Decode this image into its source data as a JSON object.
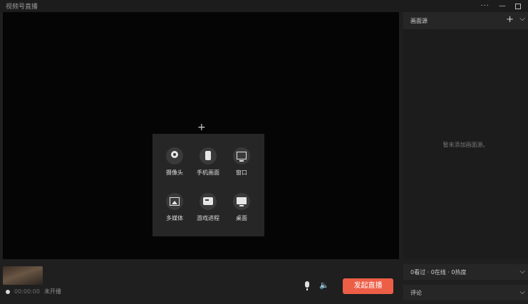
{
  "window": {
    "title": "视频号直播",
    "more_glyph": "···",
    "minimize_glyph": "—"
  },
  "preview": {
    "add_glyph": "+",
    "sources": [
      {
        "label": "摄像头",
        "icon": "camera-icon"
      },
      {
        "label": "手机画面",
        "icon": "phone-icon"
      },
      {
        "label": "窗口",
        "icon": "window-icon"
      },
      {
        "label": "多媒体",
        "icon": "media-icon"
      },
      {
        "label": "游戏进程",
        "icon": "game-icon"
      },
      {
        "label": "桌面",
        "icon": "desktop-icon"
      }
    ]
  },
  "bottom": {
    "timer": "00:00:00",
    "status": "未开播",
    "speaker_glyph": "🔈",
    "go_live_label": "发起直播"
  },
  "side_panel": {
    "title": "画面源",
    "add_glyph": "+",
    "chevron_glyph": "⌵",
    "empty_tip": "暂未添加画面源。"
  },
  "stats": {
    "label": "0看过 · 0在线 · 0热度",
    "chevron_glyph": "⌵"
  },
  "comments": {
    "label": "评论",
    "chevron_glyph": "⌵"
  },
  "colors": {
    "accent": "#ed5e47",
    "background": "#1f1f1f",
    "preview": "#050505"
  }
}
